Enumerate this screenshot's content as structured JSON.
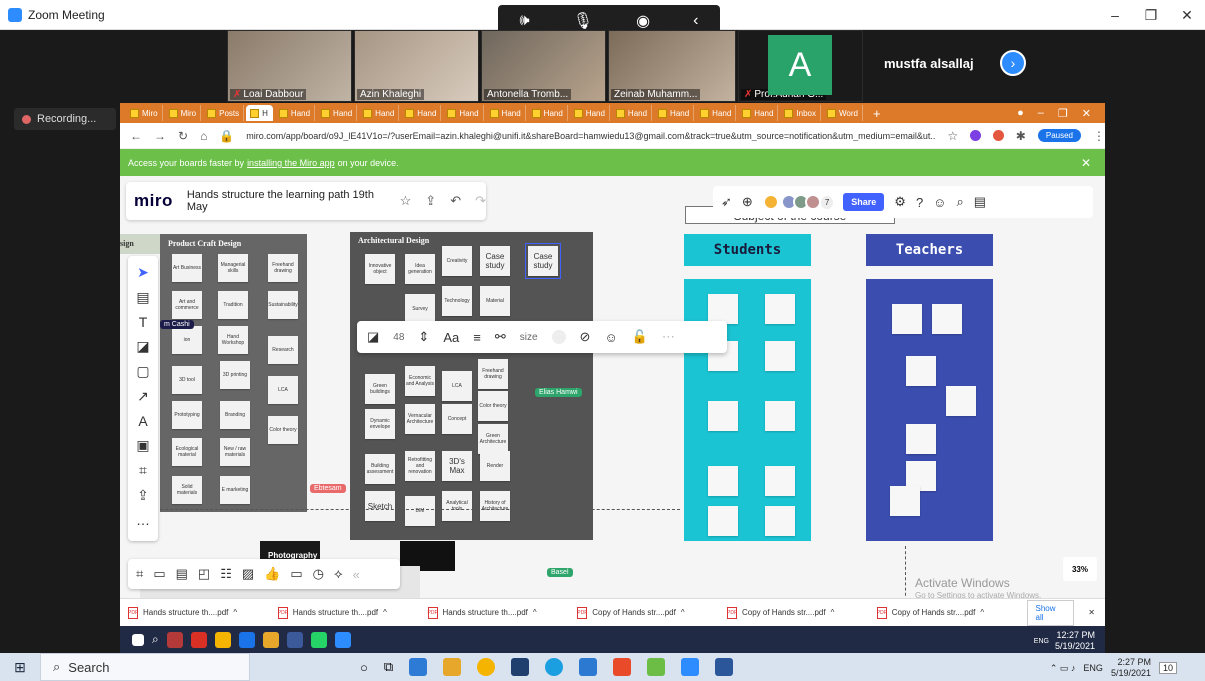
{
  "zoom": {
    "title": "Zoom Meeting",
    "recording": "Recording...",
    "participants": [
      {
        "name": "Loai Dabbour"
      },
      {
        "name": "Azin Khaleghi"
      },
      {
        "name": "Antonella Tromb..."
      },
      {
        "name": "Zeinab Muhamm..."
      },
      {
        "name": "Prof.Adnan G..."
      },
      {
        "name": "mustfa alsallaj"
      }
    ],
    "avatar_letter": "A"
  },
  "browser": {
    "tabs": [
      "Miro",
      "Miro",
      "Posts",
      "H",
      "Hand",
      "Hand",
      "Hand",
      "Hand",
      "Hand",
      "Hand",
      "Hand",
      "Hand",
      "Hand",
      "Hand",
      "Hand",
      "Hand",
      "Inbox",
      "Word"
    ],
    "active_tab": "H",
    "url": "miro.com/app/board/o9J_lE41V1o=/?userEmail=azin.khaleghi@unifi.it&shareBoard=hamwiedu13@gmail.com&track=true&utm_source=notification&utm_medium=email&ut...",
    "paused": "Paused",
    "infobar_prefix": "Access your boards faster by",
    "infobar_link": "installing the Miro app",
    "infobar_suffix": "on your device."
  },
  "miro": {
    "logo": "miro",
    "board_title": "Hands structure the learning path 19th May",
    "share": "Share",
    "avatar_count": "7",
    "subject": "Subject of the course",
    "zoom_level": "33%",
    "text_size": "48",
    "font_label": "Aa",
    "size_label": "size",
    "frames": {
      "design_label": "sign",
      "product_label": "Product Craft Design",
      "architectural_label": "Architectural Design",
      "photography_label": "Photography",
      "students": "Students",
      "teachers": "Teachers"
    },
    "product_notes": [
      "Art Business",
      "Managerial skills",
      "Freehand drawing",
      "Art and commerce",
      "Tradition",
      "Sustainability",
      "ion",
      "Hand Workshop",
      "Research",
      "3D tool",
      "3D printing",
      "LCA",
      "Prototyping",
      "Branding",
      "Color theory",
      "Ecological material",
      "New / raw materials",
      "Solid materials",
      "E marketing"
    ],
    "arch_notes": [
      "Innovative object",
      "Idea generation",
      "Creativity",
      "Case study",
      "Case study",
      "Technology",
      "Survey",
      "Material",
      "Green buildings",
      "Economic and Analysis",
      "LCA",
      "Freehand drawing",
      "Color theory",
      "Dynamic envelope",
      "Vernacular Architecture",
      "Concept",
      "Green Architecture",
      "Building assessment",
      "Retrofitting and renovation",
      "3D's Max",
      "Render",
      "Sketch",
      "BIM",
      "Analytical tools",
      "History of Architecture"
    ],
    "cursors": [
      {
        "name": "m Cashi",
        "color": "#1c1c4a"
      },
      {
        "name": "Elias Hamwi",
        "color": "#2ea56b"
      },
      {
        "name": "Ebtesam",
        "color": "#e86a6a"
      },
      {
        "name": "Basel",
        "color": "#2ea56b"
      }
    ],
    "activate_windows": "Activate Windows",
    "activate_hint": "Go to Settings to activate Windows."
  },
  "downloads": {
    "items": [
      "Hands structure th....pdf",
      "Hands structure th....pdf",
      "Hands structure th....pdf",
      "Copy of Hands str....pdf",
      "Copy of Hands str....pdf",
      "Copy of Hands str....pdf"
    ],
    "show_all": "Show all"
  },
  "remote_clock": {
    "time": "12:27 PM",
    "date": "5/19/2021",
    "lang": "ENG"
  },
  "local_taskbar": {
    "search": "Search",
    "time": "2:27 PM",
    "date": "5/19/2021",
    "lang": "ENG",
    "notif": "10"
  }
}
